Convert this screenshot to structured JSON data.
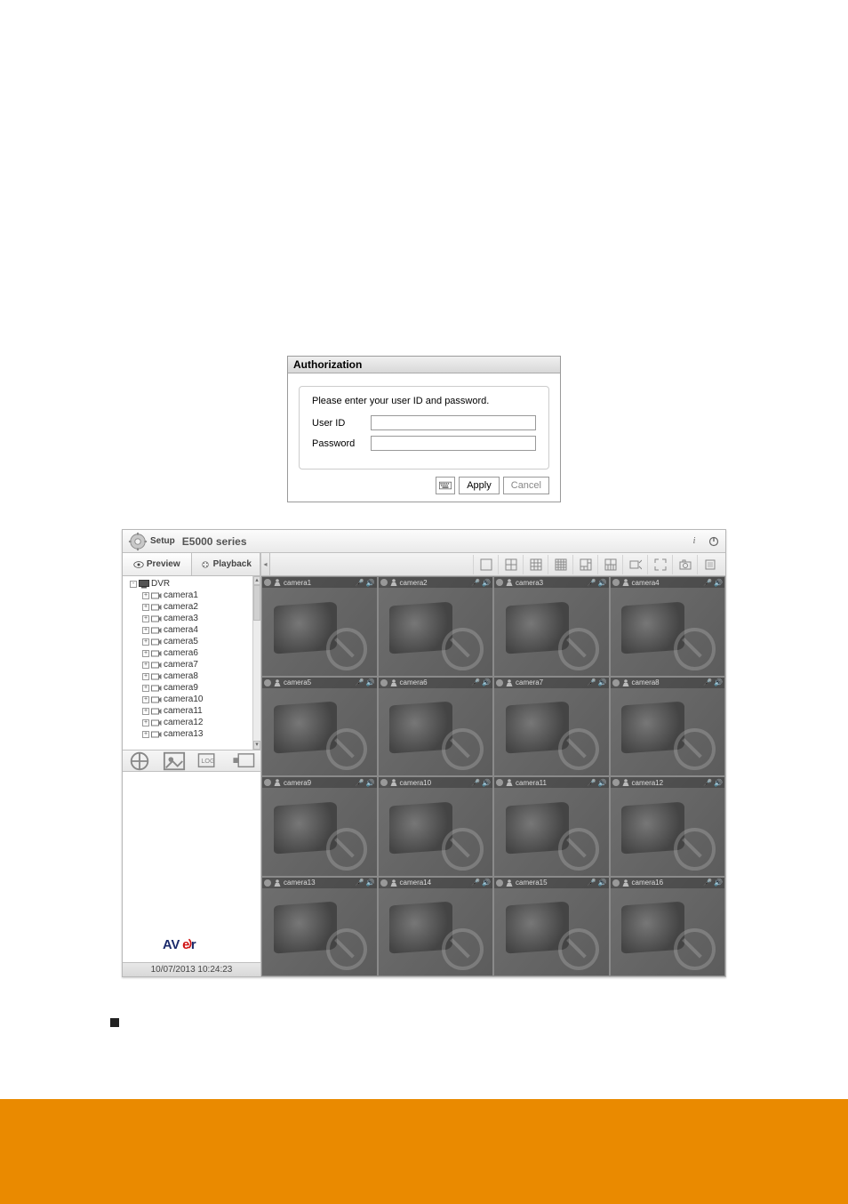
{
  "auth": {
    "title": "Authorization",
    "message": "Please enter your user ID and password.",
    "user_label": "User ID",
    "password_label": "Password",
    "apply": "Apply",
    "cancel": "Cancel"
  },
  "dvr": {
    "setup_label": "Setup",
    "series": "E5000 series",
    "tabs": {
      "preview": "Preview",
      "playback": "Playback"
    },
    "tree": {
      "root": "DVR",
      "items": [
        "camera1",
        "camera2",
        "camera3",
        "camera4",
        "camera5",
        "camera6",
        "camera7",
        "camera8",
        "camera9",
        "camera10",
        "camera11",
        "camera12",
        "camera13"
      ]
    },
    "cameras": [
      "camera1",
      "camera2",
      "camera3",
      "camera4",
      "camera5",
      "camera6",
      "camera7",
      "camera8",
      "camera9",
      "camera10",
      "camera11",
      "camera12",
      "camera13",
      "camera14",
      "camera15",
      "camera16"
    ],
    "logo": "AVer",
    "timestamp": "10/07/2013 10:24:23"
  },
  "bottom": {
    "bullet_line": "",
    "link_prefix": "",
    "link_text": ""
  }
}
